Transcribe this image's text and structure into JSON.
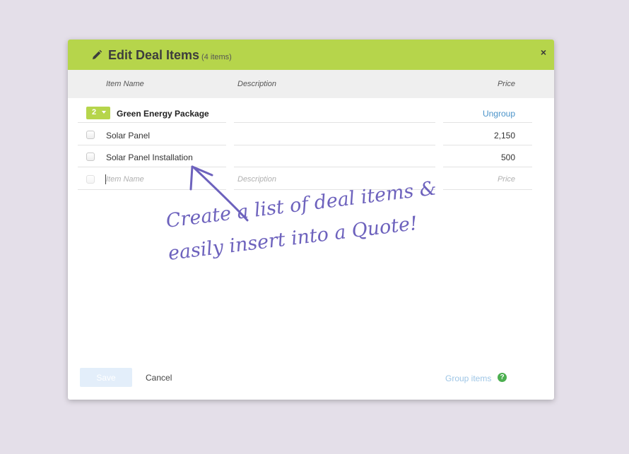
{
  "dialog": {
    "title": "Edit Deal Items",
    "count": "(4 items)",
    "close_label": "×"
  },
  "columns": {
    "item_name": "Item Name",
    "description": "Description",
    "price": "Price"
  },
  "group": {
    "badge_number": "2",
    "name": "Green Energy Package",
    "ungroup_label": "Ungroup"
  },
  "items": [
    {
      "name": "Solar Panel",
      "price": "2,150"
    },
    {
      "name": "Solar Panel Installation",
      "price": "500"
    }
  ],
  "new_row": {
    "name_placeholder": "Item Name",
    "description_placeholder": "Description",
    "price_placeholder": "Price"
  },
  "footer": {
    "save_label": "Save",
    "cancel_label": "Cancel",
    "group_items_label": "Group items",
    "help_label": "?"
  },
  "annotation": {
    "line1": "Create a list of deal items &",
    "line2": "easily insert into a Quote!"
  },
  "colors": {
    "header_green": "#b6d54b",
    "link_blue": "#4a93c9",
    "annotation_purple": "#6d62bd",
    "help_green": "#4caf50"
  },
  "icons": [
    "pencil-icon",
    "close-icon",
    "chevron-down-icon",
    "help-icon",
    "arrow-icon"
  ]
}
